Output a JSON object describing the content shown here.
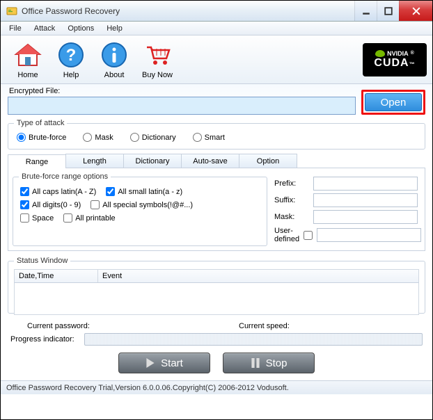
{
  "window": {
    "title": "Office Password Recovery"
  },
  "menu": {
    "file": "File",
    "attack": "Attack",
    "options": "Options",
    "help": "Help"
  },
  "toolbar": {
    "home": "Home",
    "help": "Help",
    "about": "About",
    "buy": "Buy Now"
  },
  "cuda": {
    "brand": "NVIDIA",
    "tech": "CUDA"
  },
  "file": {
    "label": "Encrypted File:",
    "value": "",
    "open": "Open"
  },
  "attack": {
    "legend": "Type of attack",
    "brute": "Brute-force",
    "mask": "Mask",
    "dict": "Dictionary",
    "smart": "Smart",
    "selected": "brute"
  },
  "tabs": {
    "range": "Range",
    "length": "Length",
    "dictionary": "Dictionary",
    "autosave": "Auto-save",
    "option": "Option"
  },
  "range": {
    "legend": "Brute-force range options",
    "caps": "All caps latin(A - Z)",
    "small": "All small latin(a - z)",
    "digits": "All digits(0 - 9)",
    "symbols": "All special symbols(!@#...)",
    "space": "Space",
    "printable": "All printable",
    "caps_v": true,
    "small_v": true,
    "digits_v": true,
    "symbols_v": false,
    "space_v": false,
    "printable_v": false,
    "prefix": "Prefix:",
    "suffix": "Suffix:",
    "maskl": "Mask:",
    "userdef": "User-defined",
    "prefix_v": "",
    "suffix_v": "",
    "mask_v": "",
    "userdef_on": false,
    "userdef_v": ""
  },
  "status": {
    "legend": "Status Window",
    "col_time": "Date,Time",
    "col_event": "Event"
  },
  "current": {
    "pwd_label": "Current password:",
    "speed_label": "Current speed:",
    "prog_label": "Progress indicator:"
  },
  "buttons": {
    "start": "Start",
    "stop": "Stop"
  },
  "footer": "Office Password Recovery Trial,Version 6.0.0.06.Copyright(C) 2006-2012 Vodusoft."
}
